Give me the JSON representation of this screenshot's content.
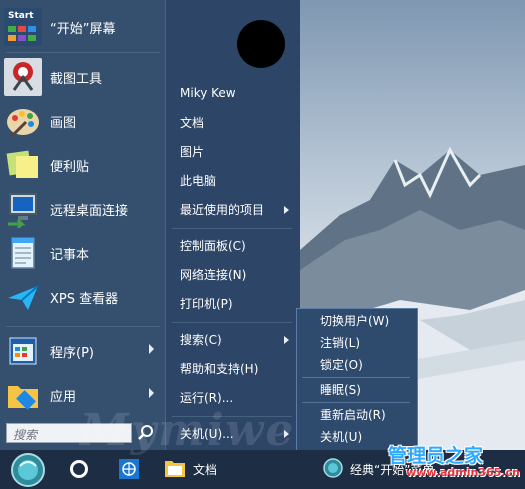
{
  "pinned": [
    {
      "label": "“开始”屏幕",
      "icon": "start-screen-icon",
      "tile_text": "Start"
    },
    {
      "label": "截图工具",
      "icon": "snipping-tool-icon"
    },
    {
      "label": "画图",
      "icon": "paint-palette-icon"
    },
    {
      "label": "便利贴",
      "icon": "sticky-notes-icon"
    },
    {
      "label": "远程桌面连接",
      "icon": "remote-desktop-icon"
    },
    {
      "label": "记事本",
      "icon": "notepad-icon"
    },
    {
      "label": "XPS 查看器",
      "icon": "xps-viewer-icon"
    }
  ],
  "programs": {
    "label": "程序(P)",
    "icon": "programs-icon"
  },
  "apps": {
    "label": "应用",
    "icon": "apps-icon"
  },
  "search": {
    "placeholder": "搜索"
  },
  "right_menu": {
    "user_name": "Miky Kew",
    "items": [
      "文档",
      "图片",
      "此电脑",
      "最近使用的项目",
      "控制面板(C)",
      "网络连接(N)",
      "打印机(P)",
      "搜索(C)",
      "帮助和支持(H)",
      "运行(R)...",
      "关机(U)..."
    ]
  },
  "shutdown_menu": {
    "items": [
      "切换用户(W)",
      "注销(L)",
      "锁定(O)",
      "睡眠(S)",
      "重新启动(R)",
      "关机(U)"
    ]
  },
  "taskbar": {
    "docs_label": "文档",
    "classic_label": "经典“开始”菜单"
  },
  "watermark": {
    "text": "Mymiwe"
  },
  "site_logo": {
    "line1": "管理员之家",
    "line2": "www.admin365.cn"
  },
  "colors": {
    "menu_bg": "#31486a",
    "taskbar_bg": "#1d2e44",
    "submenu_border": "#5c7ea6"
  }
}
